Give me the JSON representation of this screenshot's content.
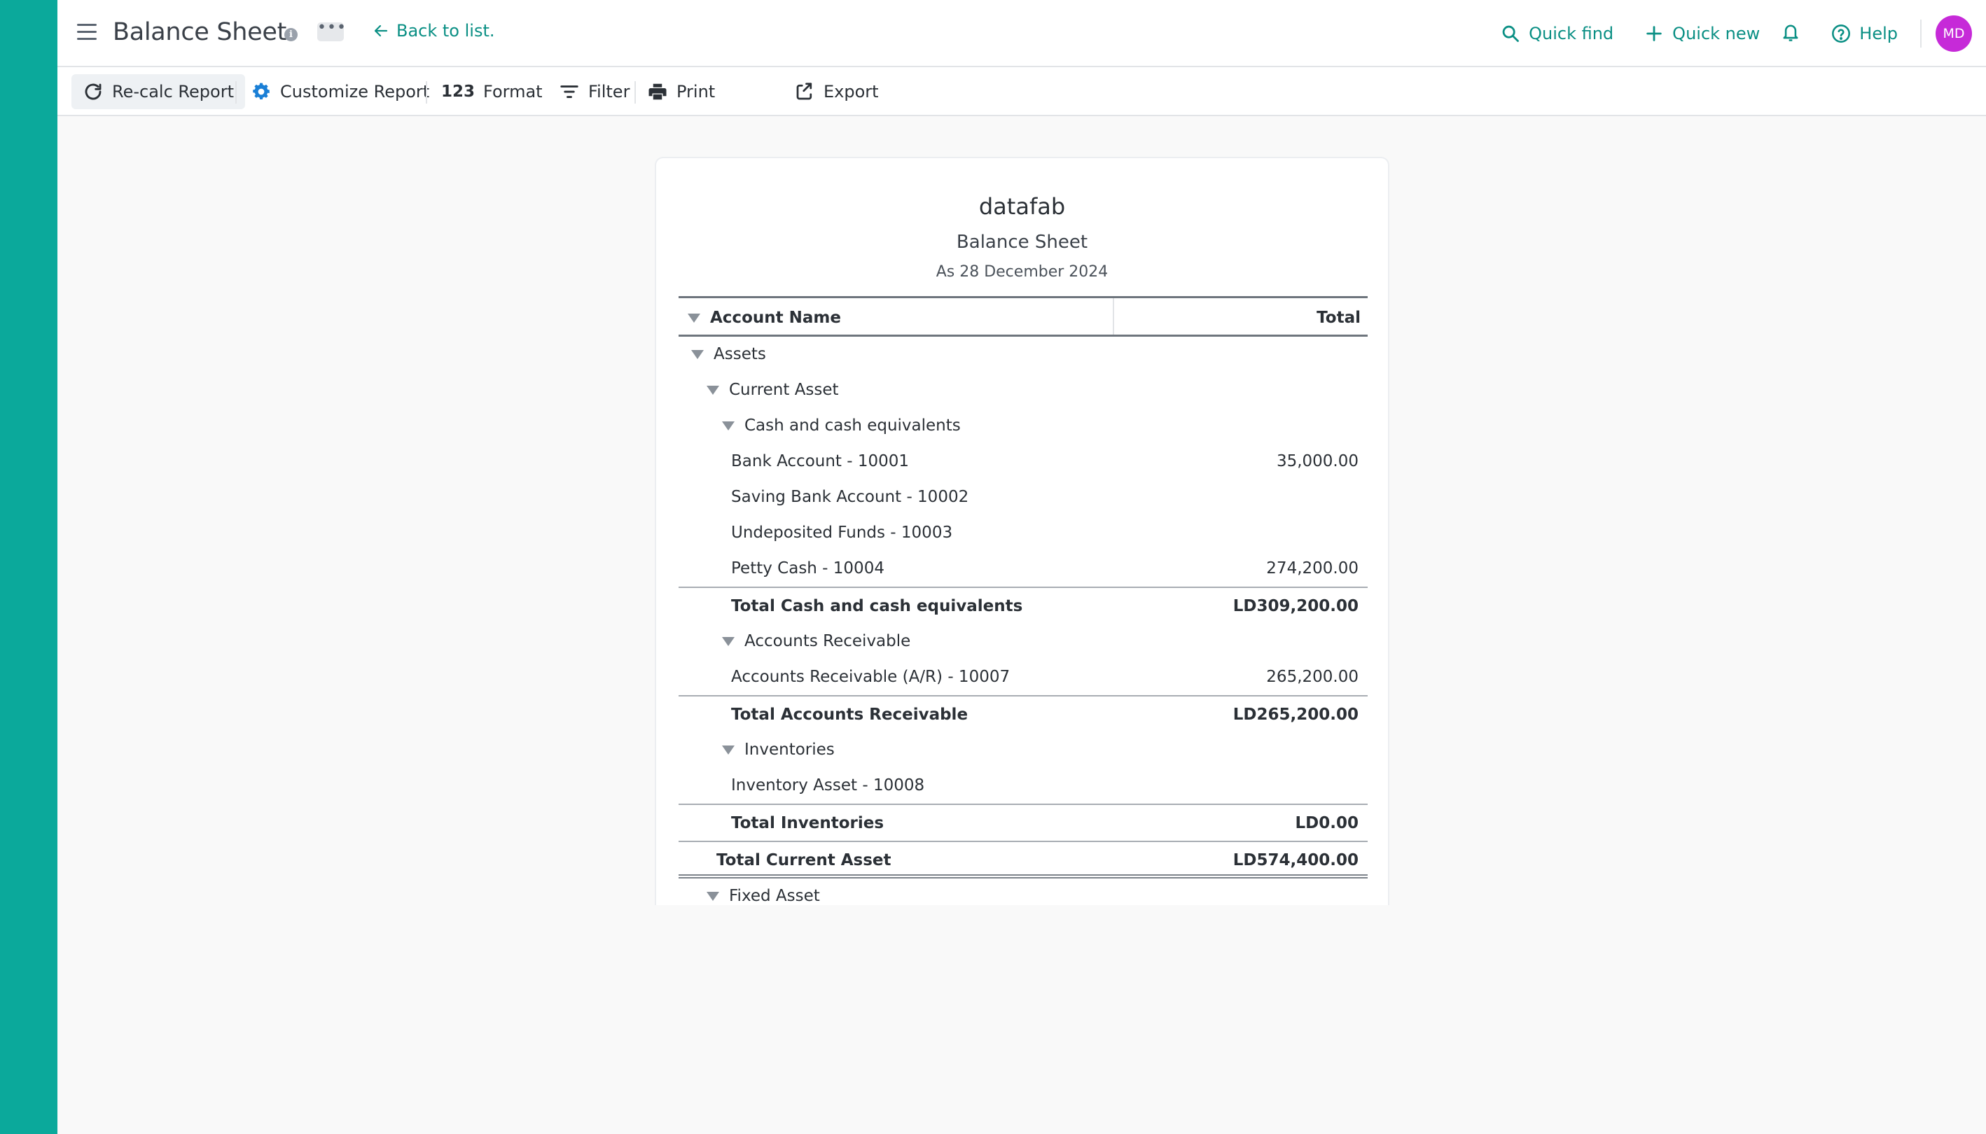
{
  "header": {
    "title": "Balance Sheet",
    "more_label": "•••",
    "back_label": "Back to list.",
    "quick_find": "Quick find",
    "quick_new": "Quick new",
    "help": "Help",
    "avatar_initials": "MD"
  },
  "toolbar": {
    "recalc": "Re-calc Report",
    "customize": "Customize Report",
    "format_icon": "123",
    "format": "Format",
    "filter": "Filter",
    "print": "Print",
    "export": "Export"
  },
  "report": {
    "company": "datafab",
    "name": "Balance Sheet",
    "date": "As 28 December 2024",
    "col_name": "Account Name",
    "col_total": "Total",
    "rows": [
      {
        "label": "Assets",
        "amount": "",
        "level": 0,
        "type": "group"
      },
      {
        "label": "Current Asset",
        "amount": "",
        "level": 1,
        "type": "group"
      },
      {
        "label": "Cash and cash equivalents",
        "amount": "",
        "level": 2,
        "type": "group"
      },
      {
        "label": "Bank Account - 10001",
        "amount": "35,000.00",
        "level": 3,
        "type": "account"
      },
      {
        "label": "Saving Bank Account - 10002",
        "amount": "",
        "level": 3,
        "type": "account"
      },
      {
        "label": "Undeposited Funds - 10003",
        "amount": "",
        "level": 3,
        "type": "account"
      },
      {
        "label": "Petty Cash - 10004",
        "amount": "274,200.00",
        "level": 3,
        "type": "account"
      },
      {
        "label": "Total Cash and cash equivalents",
        "amount": "LD309,200.00",
        "level": 3,
        "type": "total"
      },
      {
        "label": "Accounts Receivable",
        "amount": "",
        "level": 2,
        "type": "group"
      },
      {
        "label": "Accounts Receivable (A/R) - 10007",
        "amount": "265,200.00",
        "level": 3,
        "type": "account"
      },
      {
        "label": "Total Accounts Receivable",
        "amount": "LD265,200.00",
        "level": 3,
        "type": "total"
      },
      {
        "label": "Inventories",
        "amount": "",
        "level": 2,
        "type": "group"
      },
      {
        "label": "Inventory Asset - 10008",
        "amount": "",
        "level": 3,
        "type": "account"
      },
      {
        "label": "Total Inventories",
        "amount": "LD0.00",
        "level": 3,
        "type": "total"
      },
      {
        "label": "Total Current Asset",
        "amount": "LD574,400.00",
        "level": 2,
        "type": "grand"
      },
      {
        "label": "Fixed Asset",
        "amount": "",
        "level": 1,
        "type": "group"
      }
    ]
  },
  "colors": {
    "accent": "#0ba99b",
    "link": "#0a8f84",
    "avatar": "#c62ad8"
  }
}
